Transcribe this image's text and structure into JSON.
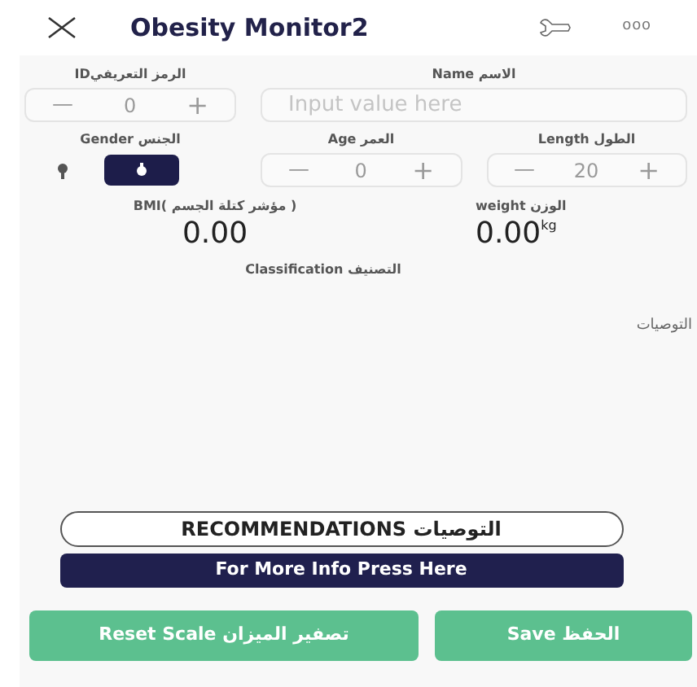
{
  "window": {
    "title": "Obesity Monitor2",
    "menu": "ooo"
  },
  "id_field": {
    "label": "IDالرمز التعريفي",
    "minus": "—",
    "value": "0",
    "plus": "+"
  },
  "name_field": {
    "label": "Name الاسم",
    "placeholder": "Input value here"
  },
  "gender": {
    "label": "Gender الجنس",
    "options": [
      {
        "kind": "female",
        "selected": false
      },
      {
        "kind": "male",
        "selected": true
      }
    ]
  },
  "age_field": {
    "label": "Age العمر",
    "minus": "—",
    "value": "0",
    "plus": "+"
  },
  "length_field": {
    "label": "Length الطول",
    "minus": "—",
    "value": "20",
    "plus": "+"
  },
  "bmi": {
    "label": "BMI( مؤشر كتلة الجسم )",
    "value": "0.00"
  },
  "weight": {
    "label": "weight الوزن",
    "value": "0.00",
    "unit": "kg"
  },
  "classification": {
    "label": "Classification التصنيف"
  },
  "recommendations_text": "التوصيات",
  "recommendations_title": "RECOMMENDATIONS التوصيات",
  "more_info_button": "For More Info Press Here",
  "reset_button": "Reset Scale تصفير الميزان",
  "save_button": "Save الحفظ"
}
